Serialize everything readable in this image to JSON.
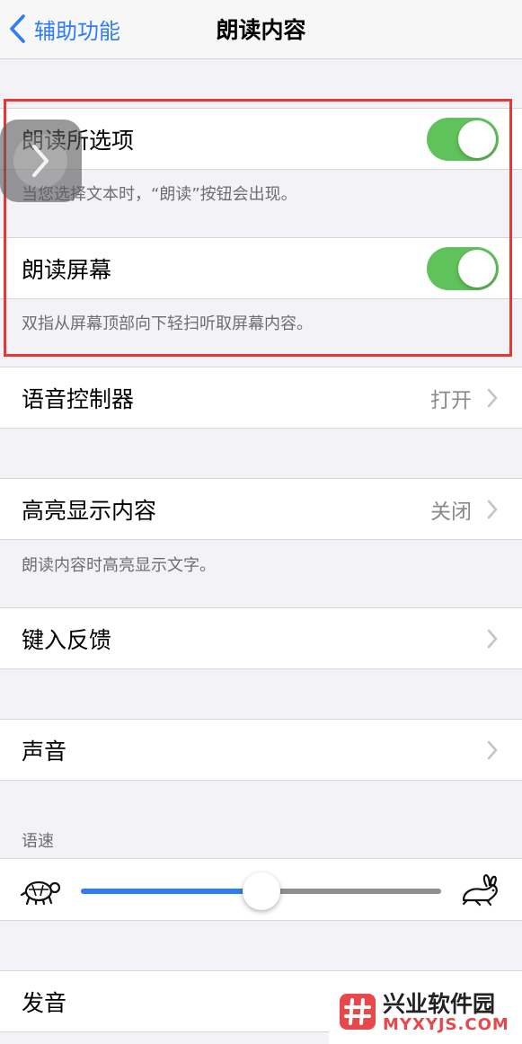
{
  "navbar": {
    "back_label": "辅助功能",
    "title": "朗读内容"
  },
  "speak_selection": {
    "label": "朗读所选项",
    "toggle_on": true,
    "footer": "当您选择文本时，“朗读”按钮会出现。"
  },
  "speak_screen": {
    "label": "朗读屏幕",
    "toggle_on": true,
    "footer": "双指从屏幕顶部向下轻扫听取屏幕内容。"
  },
  "speech_controller": {
    "label": "语音控制器",
    "value": "打开"
  },
  "highlight_content": {
    "label": "高亮显示内容",
    "value": "关闭",
    "footer": "朗读内容时高亮显示文字。"
  },
  "typing_feedback": {
    "label": "键入反馈"
  },
  "voices": {
    "label": "声音"
  },
  "speaking_rate": {
    "header": "语速",
    "value_fraction": 0.5,
    "slow_icon": "turtle-icon",
    "fast_icon": "rabbit-icon"
  },
  "pronunciations": {
    "label": "发音"
  },
  "colors": {
    "accent": "#2f7cf6",
    "toggle_on": "#5fc25a",
    "annotation": "#e53935"
  },
  "watermark": {
    "cn": "兴业软件园",
    "en": "MYXYJS.COM"
  }
}
